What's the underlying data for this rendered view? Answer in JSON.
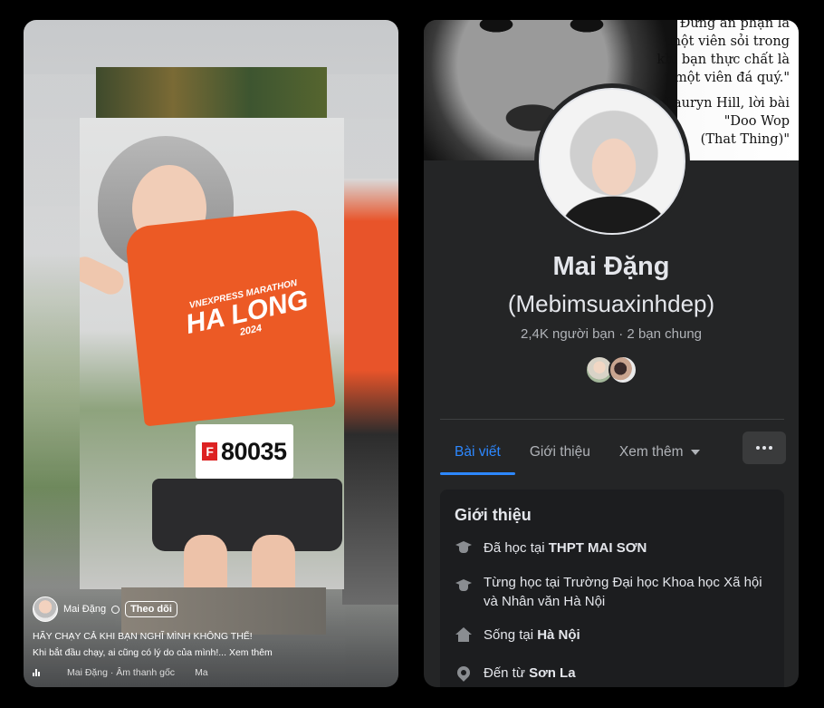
{
  "reel": {
    "author_name": "Mai Đặng",
    "follow_label": "Theo dõi",
    "caption": "HÃY CHẠY CẢ KHI BẠN NGHĨ MÌNH KHÔNG THỂ!",
    "description": "Khi bắt đầu chạy, ai cũng có lý do của mình!...",
    "see_more": "Xem thêm",
    "audio": "Mai Đặng · Âm thanh gốc",
    "audio_tail": "Ma",
    "bib_letter": "F",
    "bib_number": "80035",
    "shirt_line1": "VNEXPRESS MARATHON",
    "shirt_line2": "HA LONG",
    "shirt_line3": "2024"
  },
  "profile": {
    "cover_quote": {
      "line1": "Đừng ăn phạn là",
      "line2": "một viên sỏi trong",
      "line3": "khi bạn thực chất là",
      "line4": "một viên đá quý.\"",
      "attr1": "Lauryn Hill, lời bài",
      "attr2": "\"Doo Wop",
      "attr3": "(That Thing)\""
    },
    "name": "Mai Đặng",
    "alternate_name": "(Mebimsuaxinhdep)",
    "friends_line": "2,4K người bạn · 2 bạn chung",
    "tabs": {
      "posts": "Bài viết",
      "about": "Giới thiệu",
      "more": "Xem thêm"
    },
    "intro": {
      "title": "Giới thiệu",
      "studied_prefix": "Đã học tại ",
      "studied_school": "THPT MAI SƠN",
      "studied_univ_prefix": "Từng học tại ",
      "studied_univ": "Trường Đại học Khoa học Xã hội và Nhân văn Hà Nội",
      "lives_prefix": "Sống tại ",
      "lives_place": "Hà Nội",
      "from_prefix": "Đến từ ",
      "from_place": "Sơn La"
    }
  },
  "colors": {
    "accent": "#2d88ff",
    "panel_bg": "#242526",
    "card_bg": "#1c1d1f",
    "shirt": "#ec5a25"
  },
  "icons": [
    "globe-icon",
    "audio-icon",
    "graduation-cap-icon",
    "home-icon",
    "location-pin-icon",
    "caret-down-icon",
    "ellipsis-icon"
  ]
}
